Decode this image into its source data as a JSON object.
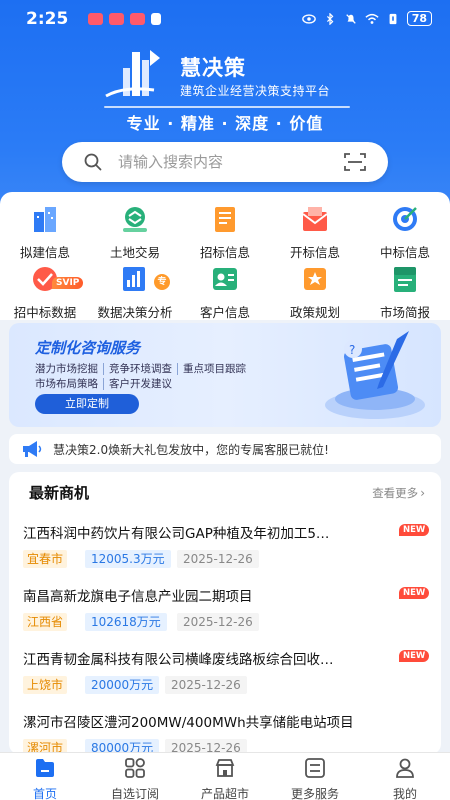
{
  "status_bar": {
    "time": "2:25",
    "battery": "78"
  },
  "brand": {
    "name": "慧决策",
    "subtitle": "建筑企业经营决策支持平台",
    "slogan": "专业 · 精准 · 深度 · 价值"
  },
  "search": {
    "placeholder": "请输入搜索内容"
  },
  "categories": [
    {
      "label": "拟建信息"
    },
    {
      "label": "土地交易"
    },
    {
      "label": "招标信息"
    },
    {
      "label": "开标信息"
    },
    {
      "label": "中标信息"
    },
    {
      "label": "招中标数据",
      "badge": "SVIP"
    },
    {
      "label": "数据决策分析",
      "badge": "专"
    },
    {
      "label": "客户信息"
    },
    {
      "label": "政策规划"
    },
    {
      "label": "市场简报"
    }
  ],
  "banner": {
    "title": "定制化咨询服务",
    "row1": [
      "潜力市场挖掘",
      "竞争环境调查",
      "重点项目跟踪"
    ],
    "row2": [
      "市场布局策略",
      "客户开发建议"
    ],
    "button": "立即定制"
  },
  "notice": {
    "text": "慧决策2.0焕新大礼包发放中，您的专属客服已就位!"
  },
  "list": {
    "title": "最新商机",
    "more": "查看更多",
    "items": [
      {
        "title": "江西科润中药饮片有限公司GAP种植及年初加工5…",
        "badge": "NEW",
        "region": "宜春市",
        "amount": "12005.3万元",
        "date": "2025-12-26"
      },
      {
        "title": "南昌高新龙旗电子信息产业园二期项目",
        "badge": "NEW",
        "region": "江西省",
        "amount": "102618万元",
        "date": "2025-12-26"
      },
      {
        "title": "江西青韧金属科技有限公司横峰废线路板综合回收…",
        "badge": "NEW",
        "region": "上饶市",
        "amount": "20000万元",
        "date": "2025-12-26"
      },
      {
        "title": "漯河市召陵区澧河200MW/400MWh共享储能电站项目",
        "badge": "",
        "region": "漯河市",
        "amount": "80000万元",
        "date": "2025-12-26"
      }
    ]
  },
  "tabs": [
    {
      "label": "首页",
      "icon": "home-icon",
      "active": true
    },
    {
      "label": "自选订阅",
      "icon": "grid-icon",
      "active": false
    },
    {
      "label": "产品超市",
      "icon": "shop-icon",
      "active": false
    },
    {
      "label": "更多服务",
      "icon": "list-icon",
      "active": false
    },
    {
      "label": "我的",
      "icon": "user-icon",
      "active": false
    }
  ],
  "colors": {
    "primary": "#1d6ff2",
    "new_badge": "#ff4b3a",
    "region_tag": "#e58a00",
    "amount_tag": "#2a78e4"
  }
}
